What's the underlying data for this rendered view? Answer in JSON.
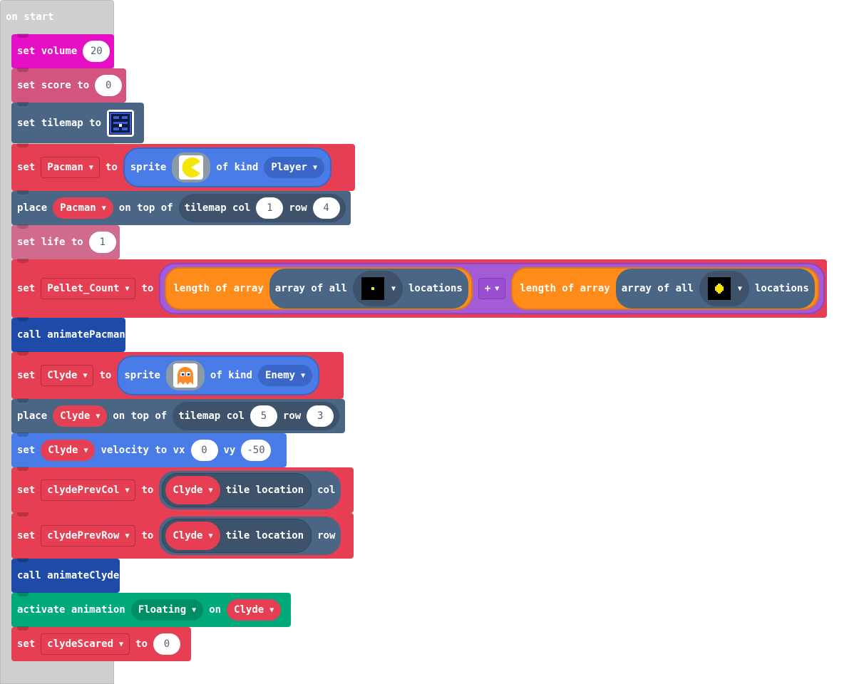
{
  "hat": {
    "label": "on start"
  },
  "blocks": {
    "volume": {
      "label": "set volume",
      "value": "20",
      "color": "#e510c5"
    },
    "score": {
      "label": "set score to",
      "value": "0",
      "color": "#d2557f"
    },
    "tilemap": {
      "label": "set tilemap to",
      "color": "#4b6584"
    },
    "pacman_set": {
      "set": "set",
      "var": "Pacman",
      "to": "to",
      "sprite": "sprite",
      "of_kind": "of kind",
      "kind": "Player",
      "color": "#e63e52"
    },
    "pacman_place": {
      "place": "place",
      "sprite": "Pacman",
      "on_top_of": "on top of",
      "tilemap_col": "tilemap col",
      "col": "1",
      "row_label": "row",
      "row": "4"
    },
    "life": {
      "label": "set life to",
      "value": "1",
      "color": "#d06a8f"
    },
    "pellet": {
      "set": "set",
      "var": "Pellet_Count",
      "to": "to",
      "length_of_array": "length of array",
      "array_of_all": "array of all",
      "locations": "locations",
      "op": "+"
    },
    "call_pacman": {
      "label": "call animatePacman",
      "color": "#1e4aa8"
    },
    "clyde_set": {
      "set": "set",
      "var": "Clyde",
      "to": "to",
      "sprite": "sprite",
      "of_kind": "of kind",
      "kind": "Enemy"
    },
    "clyde_place": {
      "place": "place",
      "sprite": "Clyde",
      "on_top_of": "on top of",
      "tilemap_col": "tilemap col",
      "col": "5",
      "row_label": "row",
      "row": "3"
    },
    "clyde_vel": {
      "set": "set",
      "sprite": "Clyde",
      "velocity": "velocity to vx",
      "vx": "0",
      "vy_label": "vy",
      "vy": "-50",
      "color": "#4a7ce8"
    },
    "prevcol": {
      "set": "set",
      "var": "clydePrevCol",
      "to": "to",
      "sprite": "Clyde",
      "tile_location": "tile location",
      "field": "col"
    },
    "prevrow": {
      "set": "set",
      "var": "clydePrevRow",
      "to": "to",
      "sprite": "Clyde",
      "tile_location": "tile location",
      "field": "row"
    },
    "call_clyde": {
      "label": "call animateClyde"
    },
    "anim": {
      "label": "activate animation",
      "anim": "Floating",
      "on": "on",
      "sprite": "Clyde",
      "color": "#00a97a"
    },
    "scared": {
      "set": "set",
      "var": "clydeScared",
      "to": "to",
      "value": "0"
    }
  },
  "icons": {
    "dropdown": "triangle-down-icon"
  }
}
